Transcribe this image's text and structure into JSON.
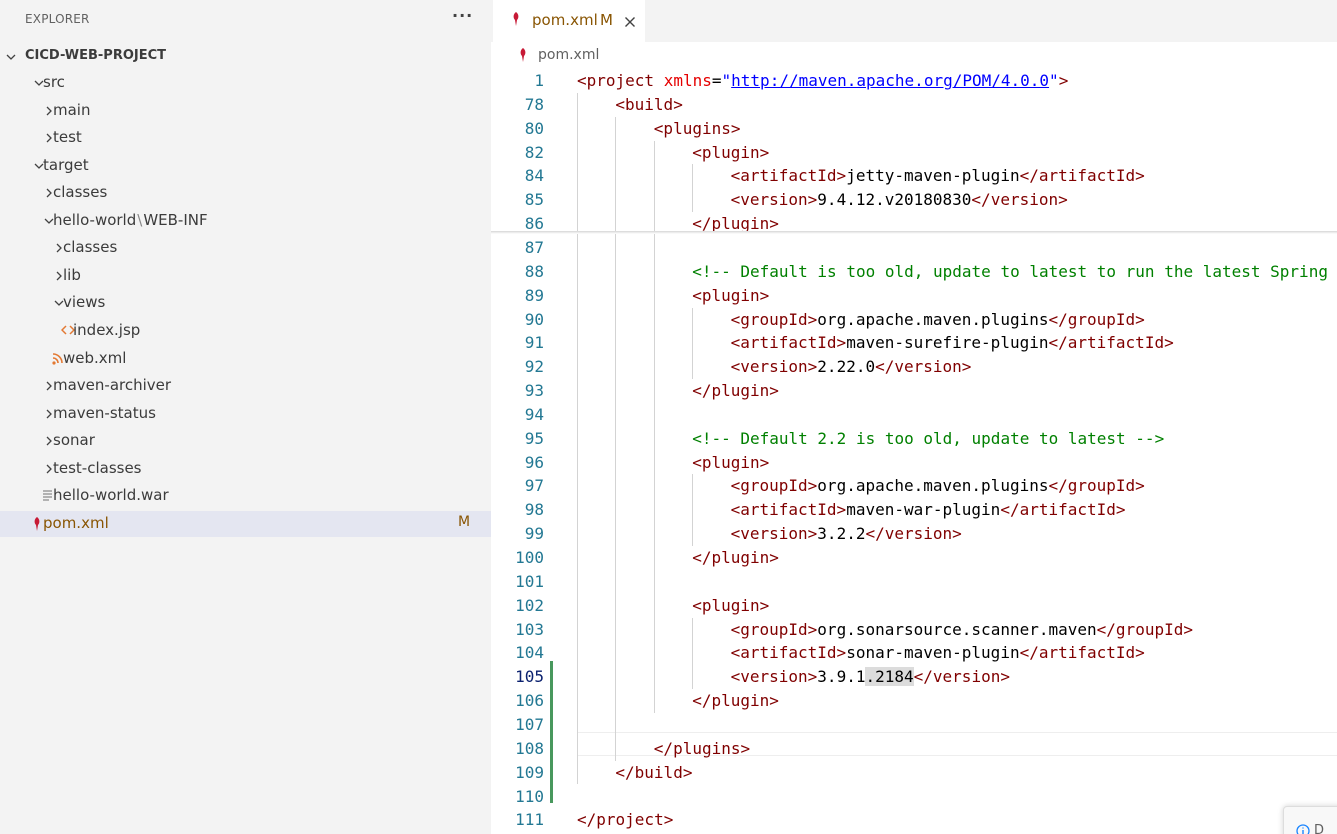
{
  "explorer": {
    "title": "EXPLORER",
    "more_label": "···",
    "project_name": "CICD-WEB-PROJECT",
    "items": [
      {
        "label": "src",
        "indent": 1,
        "kind": "folder-open",
        "icon": "chevron-down-icon"
      },
      {
        "label": "main",
        "indent": 2,
        "kind": "folder",
        "icon": "chevron-right-icon"
      },
      {
        "label": "test",
        "indent": 2,
        "kind": "folder",
        "icon": "chevron-right-icon"
      },
      {
        "label": "target",
        "indent": 1,
        "kind": "folder-open",
        "icon": "chevron-down-icon"
      },
      {
        "label": "classes",
        "indent": 2,
        "kind": "folder",
        "icon": "chevron-right-icon"
      },
      {
        "label": "hello-world",
        "label_suffix": "WEB-INF",
        "separator": "\\",
        "indent": 2,
        "kind": "folder-open",
        "icon": "chevron-down-icon"
      },
      {
        "label": "classes",
        "indent": 3,
        "kind": "folder",
        "icon": "chevron-right-icon"
      },
      {
        "label": "lib",
        "indent": 3,
        "kind": "folder",
        "icon": "chevron-right-icon"
      },
      {
        "label": "views",
        "indent": 3,
        "kind": "folder-open",
        "icon": "chevron-down-icon"
      },
      {
        "label": "index.jsp",
        "indent": 4,
        "kind": "file",
        "icon": "jsp-file-icon"
      },
      {
        "label": "web.xml",
        "indent": 3,
        "kind": "file",
        "icon": "rss-xml-file-icon"
      },
      {
        "label": "maven-archiver",
        "indent": 2,
        "kind": "folder",
        "icon": "chevron-right-icon"
      },
      {
        "label": "maven-status",
        "indent": 2,
        "kind": "folder",
        "icon": "chevron-right-icon"
      },
      {
        "label": "sonar",
        "indent": 2,
        "kind": "folder",
        "icon": "chevron-right-icon"
      },
      {
        "label": "test-classes",
        "indent": 2,
        "kind": "folder",
        "icon": "chevron-right-icon"
      },
      {
        "label": "hello-world.war",
        "indent": 2,
        "kind": "file",
        "icon": "text-file-icon"
      },
      {
        "label": "pom.xml",
        "indent": 1,
        "kind": "file",
        "icon": "maven-feather-icon",
        "badge": "M",
        "selected": true,
        "modified": true
      }
    ]
  },
  "editor": {
    "tab": {
      "label": "pom.xml",
      "badge": "M",
      "icon": "maven-feather-icon",
      "close_icon": "close-icon"
    },
    "breadcrumb": {
      "label": "pom.xml",
      "icon": "maven-feather-icon"
    },
    "active_line": "105",
    "lines": [
      {
        "n": "1",
        "indent": 0,
        "tokens": [
          [
            "tag",
            "<project "
          ],
          [
            "attr",
            "xmlns"
          ],
          [
            "txt",
            "="
          ],
          [
            "val",
            "\""
          ],
          [
            "link",
            "http://maven.apache.org/POM/4.0.0"
          ],
          [
            "val",
            "\""
          ],
          [
            "tag",
            ">"
          ]
        ]
      },
      {
        "n": "78",
        "indent": 1,
        "tokens": [
          [
            "tag",
            "<build>"
          ]
        ]
      },
      {
        "n": "80",
        "indent": 2,
        "tokens": [
          [
            "tag",
            "<plugins>"
          ]
        ]
      },
      {
        "n": "82",
        "indent": 3,
        "tokens": [
          [
            "tag",
            "<plugin>"
          ]
        ]
      },
      {
        "n": "84",
        "indent": 4,
        "tokens": [
          [
            "tag",
            "<artifactId>"
          ],
          [
            "txt",
            "jetty-maven-plugin"
          ],
          [
            "tag",
            "</artifactId>"
          ]
        ]
      },
      {
        "n": "85",
        "indent": 4,
        "tokens": [
          [
            "tag",
            "<version>"
          ],
          [
            "txt",
            "9.4.12.v20180830"
          ],
          [
            "tag",
            "</version>"
          ]
        ]
      },
      {
        "n": "86",
        "indent": 3,
        "tokens": [
          [
            "tag",
            "</plugin>"
          ]
        ]
      },
      {
        "n": "87",
        "indent": 0,
        "tokens": []
      },
      {
        "n": "88",
        "indent": 3,
        "tokens": [
          [
            "com",
            "<!-- Default is too old, update to latest to run the latest Spring"
          ]
        ]
      },
      {
        "n": "89",
        "indent": 3,
        "tokens": [
          [
            "tag",
            "<plugin>"
          ]
        ]
      },
      {
        "n": "90",
        "indent": 4,
        "tokens": [
          [
            "tag",
            "<groupId>"
          ],
          [
            "txt",
            "org.apache.maven.plugins"
          ],
          [
            "tag",
            "</groupId>"
          ]
        ]
      },
      {
        "n": "91",
        "indent": 4,
        "tokens": [
          [
            "tag",
            "<artifactId>"
          ],
          [
            "txt",
            "maven-surefire-plugin"
          ],
          [
            "tag",
            "</artifactId>"
          ]
        ]
      },
      {
        "n": "92",
        "indent": 4,
        "tokens": [
          [
            "tag",
            "<version>"
          ],
          [
            "txt",
            "2.22.0"
          ],
          [
            "tag",
            "</version>"
          ]
        ]
      },
      {
        "n": "93",
        "indent": 3,
        "tokens": [
          [
            "tag",
            "</plugin>"
          ]
        ]
      },
      {
        "n": "94",
        "indent": 0,
        "tokens": []
      },
      {
        "n": "95",
        "indent": 3,
        "tokens": [
          [
            "com",
            "<!-- Default 2.2 is too old, update to latest -->"
          ]
        ]
      },
      {
        "n": "96",
        "indent": 3,
        "tokens": [
          [
            "tag",
            "<plugin>"
          ]
        ]
      },
      {
        "n": "97",
        "indent": 4,
        "tokens": [
          [
            "tag",
            "<groupId>"
          ],
          [
            "txt",
            "org.apache.maven.plugins"
          ],
          [
            "tag",
            "</groupId>"
          ]
        ]
      },
      {
        "n": "98",
        "indent": 4,
        "tokens": [
          [
            "tag",
            "<artifactId>"
          ],
          [
            "txt",
            "maven-war-plugin"
          ],
          [
            "tag",
            "</artifactId>"
          ]
        ]
      },
      {
        "n": "99",
        "indent": 4,
        "tokens": [
          [
            "tag",
            "<version>"
          ],
          [
            "txt",
            "3.2.2"
          ],
          [
            "tag",
            "</version>"
          ]
        ]
      },
      {
        "n": "100",
        "indent": 3,
        "tokens": [
          [
            "tag",
            "</plugin>"
          ]
        ]
      },
      {
        "n": "101",
        "indent": 0,
        "tokens": []
      },
      {
        "n": "102",
        "indent": 3,
        "tokens": [
          [
            "tag",
            "<plugin>"
          ]
        ]
      },
      {
        "n": "103",
        "indent": 4,
        "tokens": [
          [
            "tag",
            "<groupId>"
          ],
          [
            "txt",
            "org.sonarsource.scanner.maven"
          ],
          [
            "tag",
            "</groupId>"
          ]
        ]
      },
      {
        "n": "104",
        "indent": 4,
        "tokens": [
          [
            "tag",
            "<artifactId>"
          ],
          [
            "txt",
            "sonar-maven-plugin"
          ],
          [
            "tag",
            "</artifactId>"
          ]
        ]
      },
      {
        "n": "105",
        "indent": 4,
        "tokens": [
          [
            "tag",
            "<version>"
          ],
          [
            "txt",
            "3.9.1"
          ],
          [
            "hl",
            ".2184"
          ],
          [
            "tag",
            "</version>"
          ]
        ]
      },
      {
        "n": "106",
        "indent": 3,
        "tokens": [
          [
            "tag",
            "</plugin>"
          ]
        ]
      },
      {
        "n": "107",
        "indent": 0,
        "tokens": []
      },
      {
        "n": "108",
        "indent": 2,
        "tokens": [
          [
            "tag",
            "</plugins>"
          ]
        ]
      },
      {
        "n": "109",
        "indent": 1,
        "tokens": [
          [
            "tag",
            "</build>"
          ]
        ]
      },
      {
        "n": "110",
        "indent": 0,
        "tokens": []
      },
      {
        "n": "111",
        "indent": 0,
        "tokens": [
          [
            "tag",
            "</project>"
          ]
        ]
      }
    ]
  },
  "notification": {
    "text": "D",
    "icon": "info-icon"
  },
  "colors": {
    "sidebar_bg": "#f3f3f3",
    "selected_row": "#e4e6f1",
    "modified": "#895503",
    "tag": "#800000",
    "attr": "#e50000",
    "value": "#0000ff",
    "comment": "#008000",
    "line_number": "#237893",
    "git_added": "#48985d"
  }
}
